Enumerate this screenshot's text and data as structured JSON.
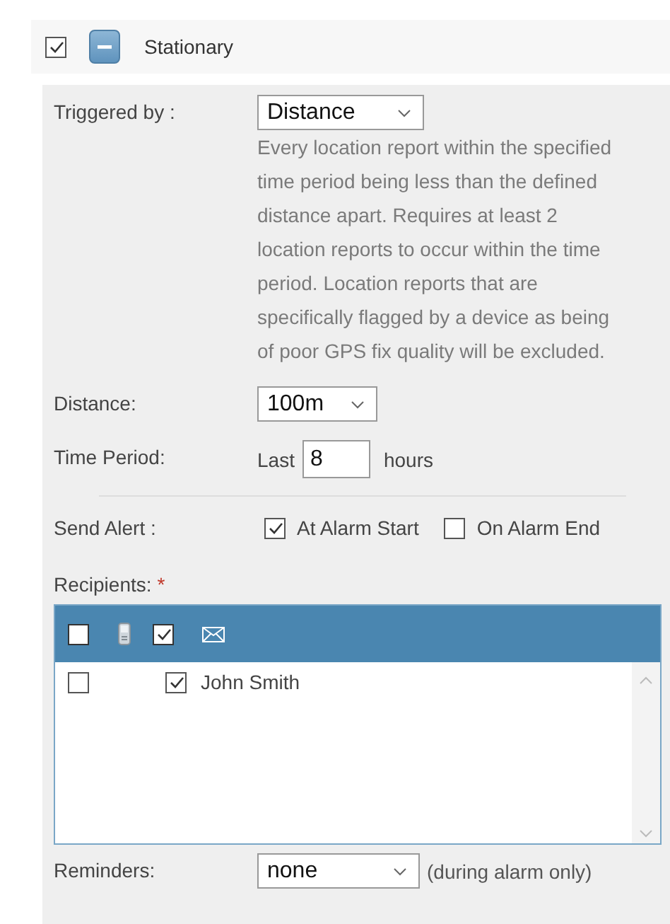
{
  "alarm": {
    "checked": true,
    "expanded": true,
    "title": "Stationary"
  },
  "triggered_by": {
    "label": "Triggered by :",
    "value": "Distance",
    "description": "Every location report within the specified time period being less than the defined distance apart. Requires at least 2 location reports to occur within the time period. Location reports that are specifically flagged by a device as being of poor GPS fix quality will be excluded."
  },
  "distance": {
    "label": "Distance:",
    "value": "100m"
  },
  "time_period": {
    "label": "Time Period:",
    "prefix": "Last",
    "value": "8",
    "suffix": "hours"
  },
  "send_alert": {
    "label": "Send Alert :",
    "options": [
      {
        "label": "At Alarm Start",
        "checked": true
      },
      {
        "label": "On Alarm End",
        "checked": false
      }
    ]
  },
  "recipients": {
    "label": "Recipients:",
    "required_mark": "*",
    "header": {
      "sms_checked": false,
      "email_checked": true
    },
    "rows": [
      {
        "name": "John Smith",
        "sms_checked": false,
        "email_checked": true
      }
    ]
  },
  "reminders": {
    "label": "Reminders:",
    "value": "none",
    "note": "(during alarm only)"
  }
}
